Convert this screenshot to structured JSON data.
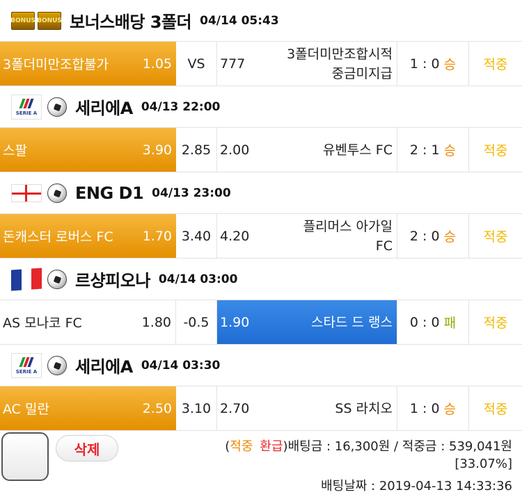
{
  "sections": [
    {
      "logo": "bonus",
      "badges": [
        "BONUS",
        "BONUS"
      ],
      "title": "보너스배당 3폴더",
      "time": "04/14 05:43",
      "row": {
        "home": "3폴더미만조합불가",
        "home_odds": "1.05",
        "home_selected": true,
        "draw": "VS",
        "away_odds": "777",
        "away": "3폴더미만조합시적중금미지급",
        "away_lines": [
          "3폴더미만조합시적",
          "중금미지급"
        ],
        "away_selected": false,
        "score": "1 : 0",
        "outcome": "승",
        "outcome_type": "win",
        "result": "적중"
      }
    },
    {
      "logo": "serie-a",
      "logo_text": "SERIE A",
      "title": "세리에A",
      "time": "04/13 22:00",
      "row": {
        "home": "스팔",
        "home_odds": "3.90",
        "home_selected": true,
        "draw": "2.85",
        "away_odds": "2.00",
        "away": "유벤투스 FC",
        "away_lines": [
          "유벤투스 FC"
        ],
        "away_selected": false,
        "score": "2 : 1",
        "outcome": "승",
        "outcome_type": "win",
        "result": "적중"
      }
    },
    {
      "logo": "england-flag",
      "title": "ENG D1",
      "time": "04/13 23:00",
      "row": {
        "home": "돈캐스터 로버스 FC",
        "home_odds": "1.70",
        "home_selected": true,
        "draw": "3.40",
        "away_odds": "4.20",
        "away": "플리머스 아가일 FC",
        "away_lines": [
          "플리머스 아가일",
          "FC"
        ],
        "away_selected": false,
        "score": "2 : 0",
        "outcome": "승",
        "outcome_type": "win",
        "result": "적중"
      }
    },
    {
      "logo": "france-flag",
      "title": "르샹피오나",
      "time": "04/14 03:00",
      "row": {
        "home": "AS 모나코 FC",
        "home_odds": "1.80",
        "home_selected": false,
        "draw": "-0.5",
        "away_odds": "1.90",
        "away": "스타드 드 랭스",
        "away_lines": [
          "스타드 드 랭스"
        ],
        "away_selected": true,
        "score": "0 : 0",
        "outcome": "패",
        "outcome_type": "lose",
        "result": "적중"
      }
    },
    {
      "logo": "serie-a",
      "logo_text": "SERIE A",
      "title": "세리에A",
      "time": "04/14 03:30",
      "row": {
        "home": "AC 밀란",
        "home_odds": "2.50",
        "home_selected": true,
        "draw": "3.10",
        "away_odds": "2.70",
        "away": "SS 라치오",
        "away_lines": [
          "SS 라치오"
        ],
        "away_selected": false,
        "score": "1 : 0",
        "outcome": "승",
        "outcome_type": "win",
        "result": "적중"
      }
    }
  ],
  "footer": {
    "delete_label": "삭제",
    "open_paren": "(",
    "hit_label": "적중",
    "refund_label": "환급",
    "bet_amount_text": ")배팅금 : 16,300원 / 적중금 : 539,041원",
    "rate": "[33.07%]",
    "bet_date": "배팅날짜 : 2019-04-13 14:33:36"
  },
  "colors": {
    "home_selected": "#e89400",
    "away_selected": "#2a7be0",
    "result": "#f2b800",
    "win": "#f08a00",
    "lose": "#8ab000",
    "delete": "#e8262a"
  }
}
